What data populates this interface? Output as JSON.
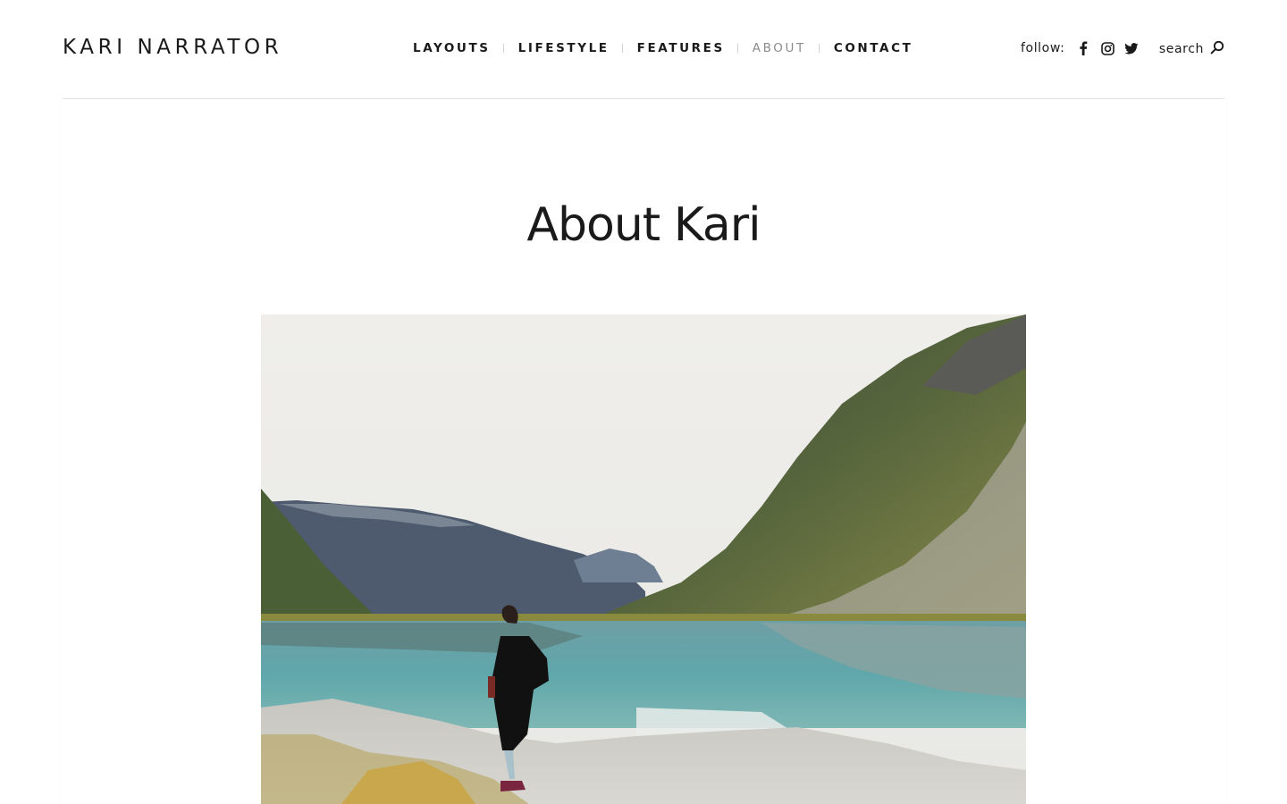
{
  "header": {
    "logo": "KARI NARRATOR",
    "nav": [
      {
        "label": "LAYOUTS",
        "active": false
      },
      {
        "label": "LIFESTYLE",
        "active": false
      },
      {
        "label": "FEATURES",
        "active": false
      },
      {
        "label": "ABOUT",
        "active": true
      },
      {
        "label": "CONTACT",
        "active": false
      }
    ],
    "follow_label": "follow:",
    "social_icons": [
      "facebook-icon",
      "instagram-icon",
      "twitter-icon"
    ],
    "search_label": "search"
  },
  "main": {
    "title": "About Kari"
  },
  "colors": {
    "text": "#1a1a1a",
    "nav_active": "#8c8c8c",
    "divider": "#e6e6e6"
  }
}
